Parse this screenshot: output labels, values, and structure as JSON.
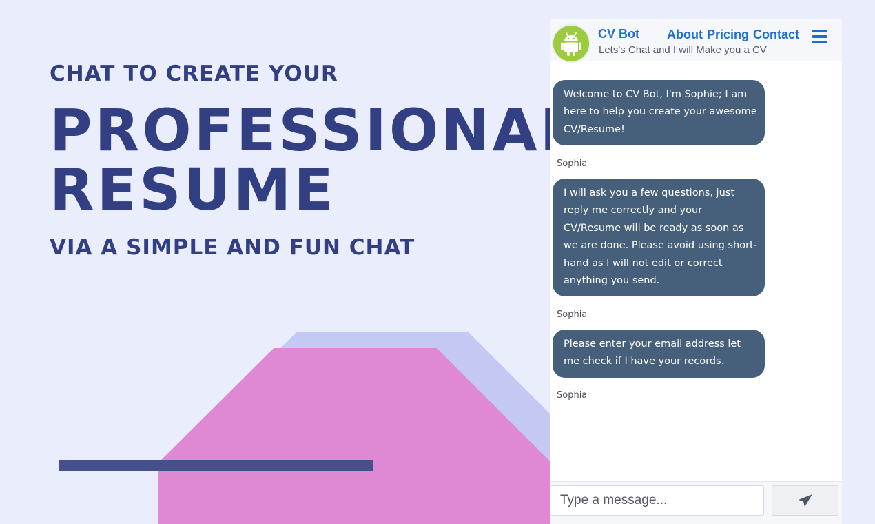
{
  "promo": {
    "line1": "CHAT TO CREATE YOUR",
    "line2": "PROFESSIONAL",
    "line3": "RESUME",
    "line4": "VIA A SIMPLE AND FUN CHAT"
  },
  "colors": {
    "background": "#eaedfb",
    "headline": "#323f82",
    "shape_light": "#c4c9f4",
    "shape_pink": "#df89d5",
    "bar": "#46518c",
    "bubble": "#465f7a",
    "link": "#1b6fd2"
  },
  "chat": {
    "header": {
      "brand": "CV Bot",
      "tagline": "Lets's Chat and I will Make you a CV",
      "nav": [
        "About",
        "Pricing",
        "Contact"
      ],
      "avatar_icon": "android-icon",
      "menu_icon": "hamburger-menu-icon"
    },
    "messages": [
      {
        "text": "Welcome to CV Bot, I'm Sophie; I am here to help you create your awesome CV/Resume!",
        "sender": "Sophia"
      },
      {
        "text": "I will ask you a few questions, just reply me correctly and your CV/Resume will be ready as soon as we are done. Please avoid using short-hand as I will not edit or correct anything you send.",
        "sender": "Sophia"
      },
      {
        "text": "Please enter your email address let me check if I have your records.",
        "sender": "Sophia"
      }
    ],
    "composer": {
      "placeholder": "Type a message...",
      "value": "",
      "send_icon": "paper-plane-icon"
    }
  }
}
